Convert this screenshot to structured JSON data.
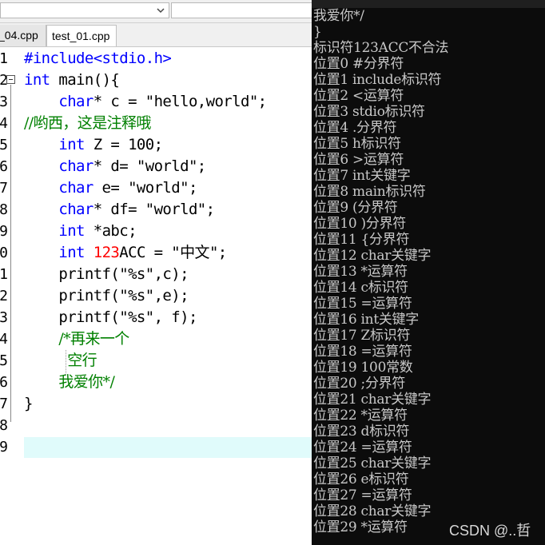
{
  "editor": {
    "tabs": [
      {
        "label": "_04.cpp",
        "active": false
      },
      {
        "label": "test_01.cpp",
        "active": true
      }
    ],
    "lines": [
      {
        "n": "1",
        "html": "<span class=\"pp\">#include&lt;stdio.h&gt;</span>"
      },
      {
        "n": "2",
        "html": "<span class=\"kw\">int</span> main(){"
      },
      {
        "n": "3",
        "html": "    <span class=\"kw\">char</span>* c = \"hello,world\";"
      },
      {
        "n": "4",
        "html": "<span class=\"cm\">//哟西，这是注释哦</span>"
      },
      {
        "n": "5",
        "html": "    <span class=\"kw\">int</span> Z = 100;"
      },
      {
        "n": "6",
        "html": "    <span class=\"kw\">char</span>* d= \"world\";"
      },
      {
        "n": "7",
        "html": "    <span class=\"kw\">char</span> e= \"world\";"
      },
      {
        "n": "8",
        "html": "    <span class=\"kw\">char</span>* df= \"world\";"
      },
      {
        "n": "9",
        "html": "    <span class=\"kw\">int</span> *abc;"
      },
      {
        "n": "0",
        "html": "    <span class=\"kw\">int</span> <span class=\"err\">123</span>ACC = \"中文\";"
      },
      {
        "n": "1",
        "html": "    printf(\"%s\",c);"
      },
      {
        "n": "2",
        "html": "    printf(\"%s\",e);"
      },
      {
        "n": "3",
        "html": "    printf(\"%s\", f);"
      },
      {
        "n": "4",
        "html": "    <span class=\"cm\">/*再来一个</span>"
      },
      {
        "n": "5",
        "html": "     <span class=\"cm\">空行</span>"
      },
      {
        "n": "6",
        "html": "    <span class=\"cm\">我爱你*/</span>"
      },
      {
        "n": "7",
        "html": "}"
      },
      {
        "n": "8",
        "html": ""
      },
      {
        "n": "9",
        "html": ""
      }
    ]
  },
  "console": {
    "lines": [
      "我爱你*/",
      "}",
      "标识符123ACC不合法",
      "位置0 #分界符",
      "位置1 include标识符",
      "位置2 <运算符",
      "位置3 stdio标识符",
      "位置4 .分界符",
      "位置5 h标识符",
      "位置6 >运算符",
      "位置7 int关键字",
      "位置8 main标识符",
      "位置9 (分界符",
      "位置10 )分界符",
      "位置11 {分界符",
      "位置12 char关键字",
      "位置13 *运算符",
      "位置14 c标识符",
      "位置15 =运算符",
      "位置16 int关键字",
      "位置17 Z标识符",
      "位置18 =运算符",
      "位置19 100常数",
      "位置20 ;分界符",
      "位置21 char关键字",
      "位置22 *运算符",
      "位置23 d标识符",
      "位置24 =运算符",
      "位置25 char关键字",
      "位置26 e标识符",
      "位置27 =运算符",
      "位置28 char关键字",
      "位置29 *运算符"
    ],
    "watermark": "CSDN @..哲"
  },
  "colors": {
    "keyword": "#0000ff",
    "comment": "#008000",
    "error": "#ff0000",
    "console_bg": "#0c0c0c",
    "console_text": "#c8c8c8",
    "current_line": "#e0fbfb"
  }
}
